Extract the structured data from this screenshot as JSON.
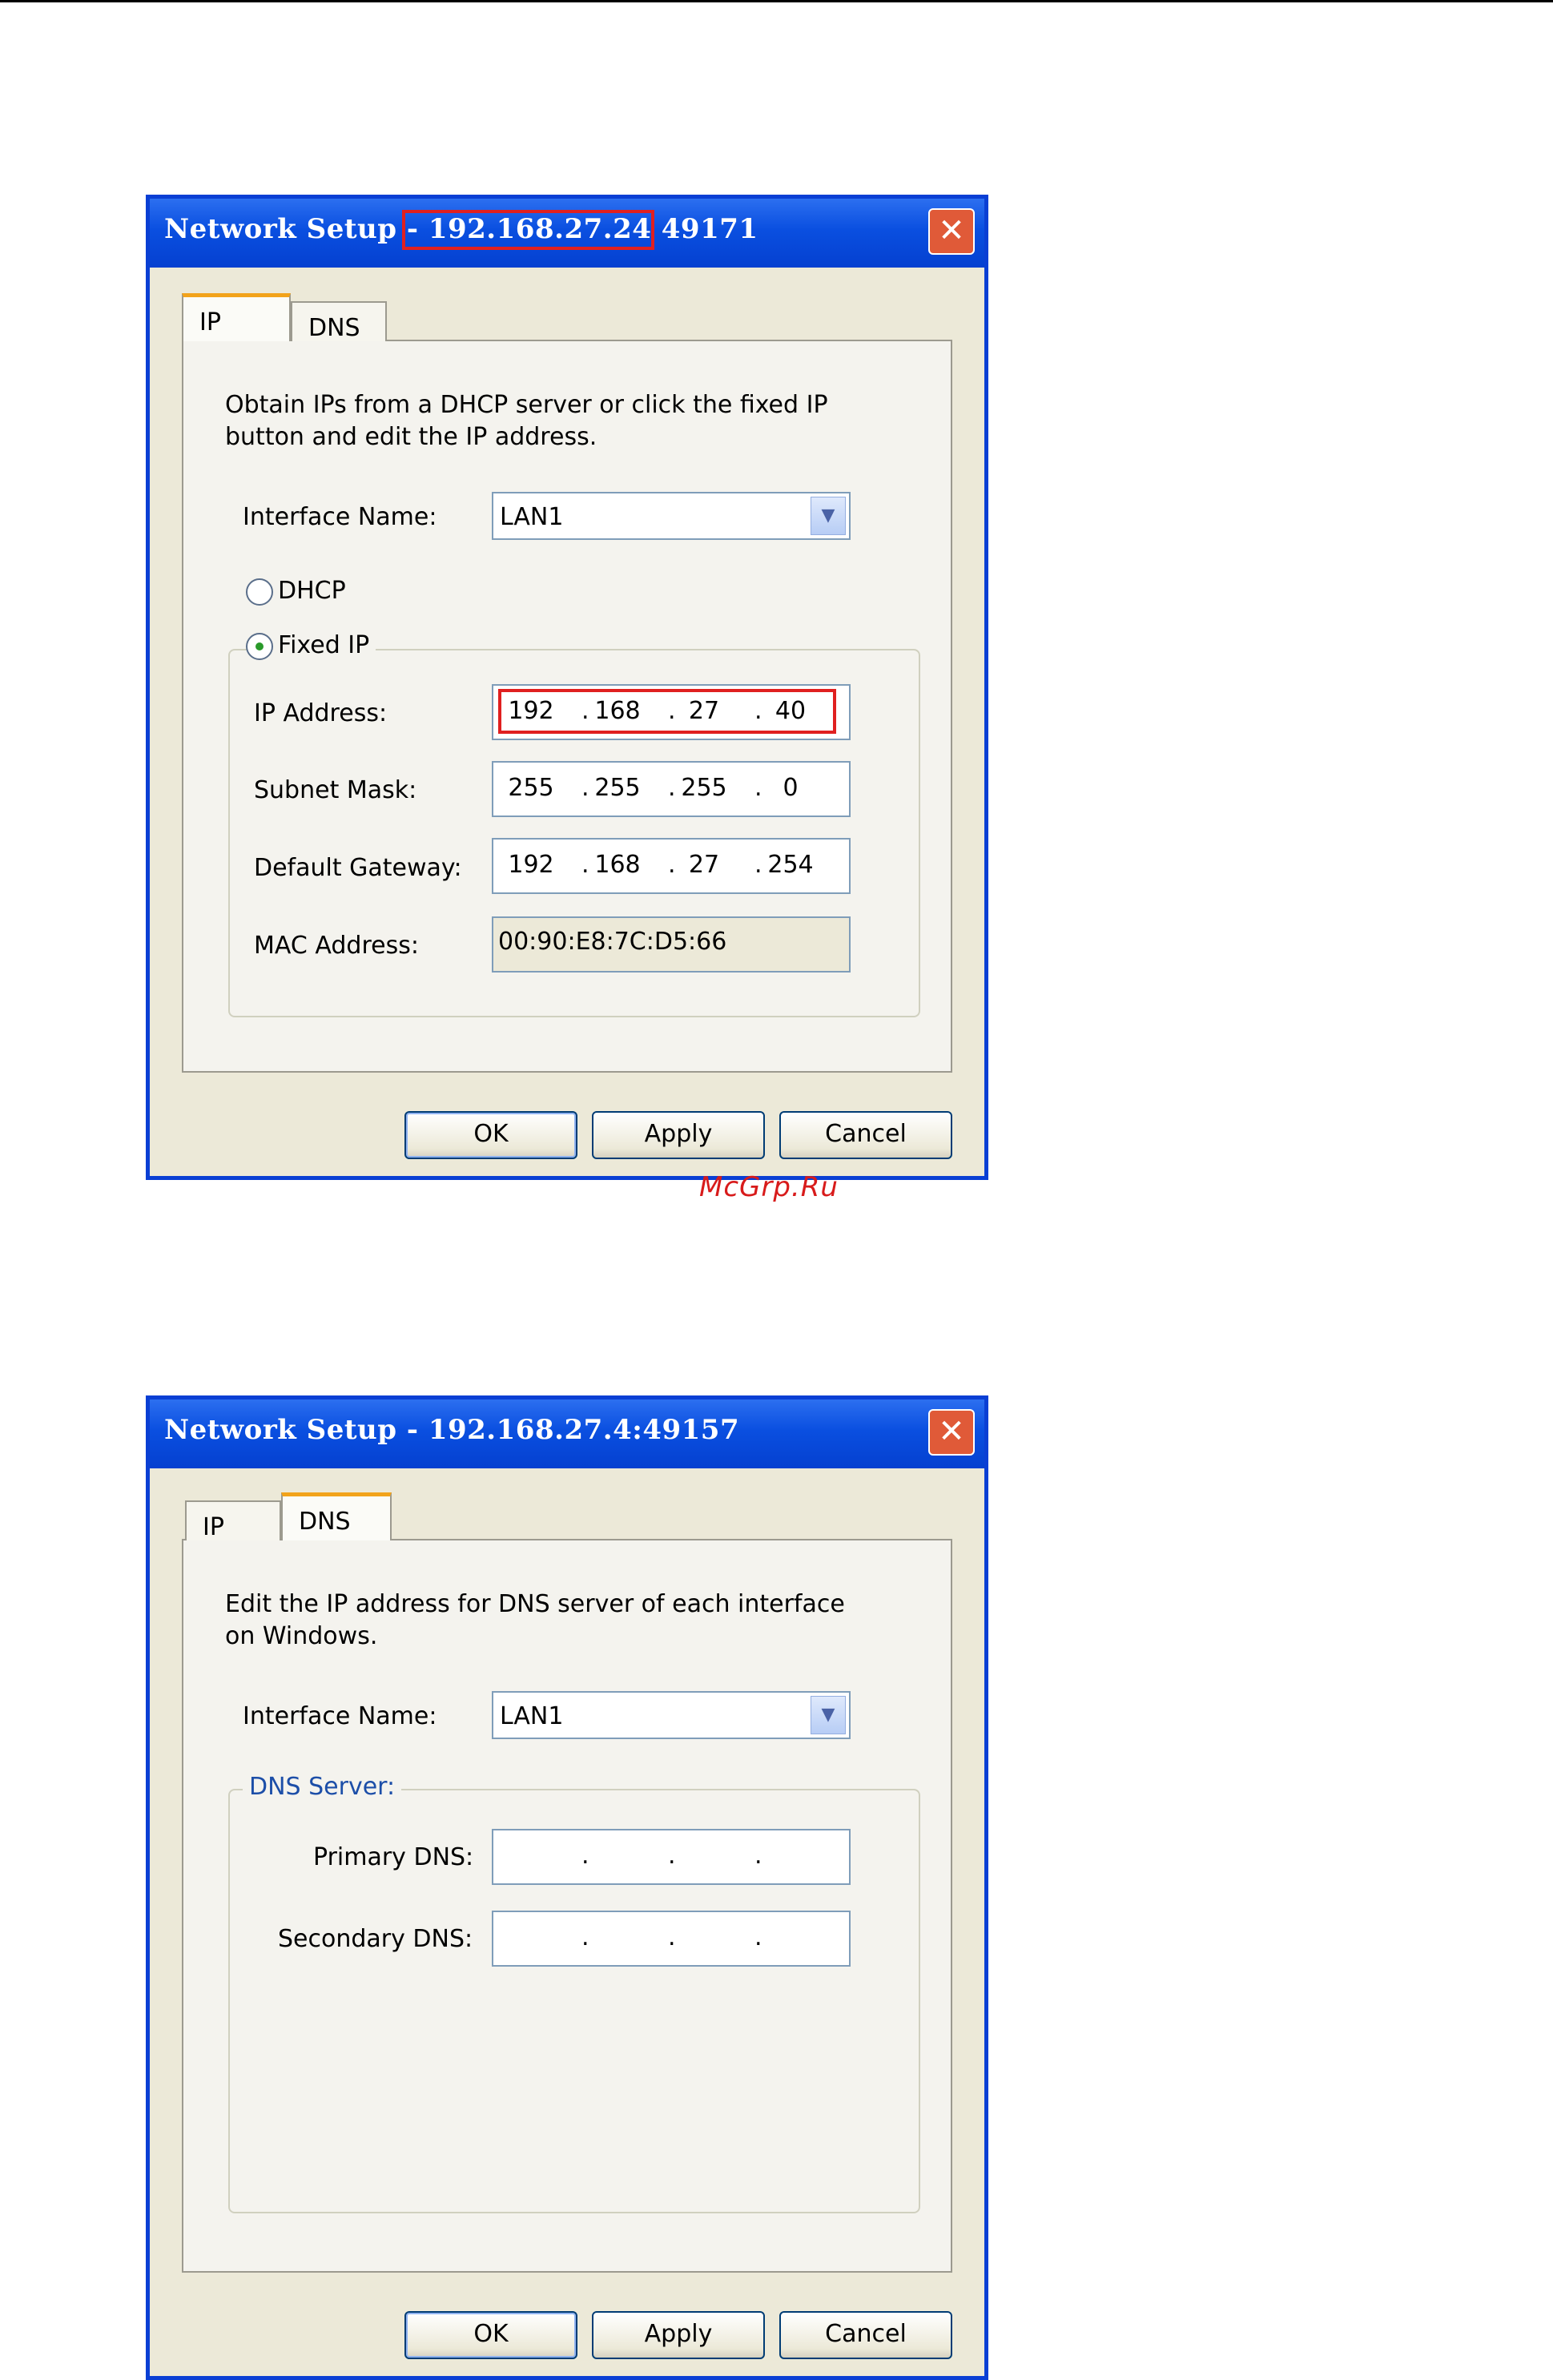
{
  "watermark": "McGrp.Ru",
  "dialog1": {
    "title_prefix": "Network Setup ",
    "title_highlighted": "- 192.168.27.24",
    "title_suffix": " 49171",
    "close_glyph": "✕",
    "tabs": [
      {
        "label": "IP",
        "active": true
      },
      {
        "label": "DNS",
        "active": false
      }
    ],
    "description": "Obtain IPs from a DHCP server or click the fixed IP button and edit the IP address.",
    "interface_label": "Interface Name:",
    "interface_value": "LAN1",
    "dhcp_label": "DHCP",
    "fixed_label": "Fixed IP",
    "selected_mode": "Fixed IP",
    "fields": {
      "ip_label": "IP Address:",
      "ip": [
        "192",
        "168",
        "27",
        "40"
      ],
      "subnet_label": "Subnet Mask:",
      "subnet": [
        "255",
        "255",
        "255",
        "0"
      ],
      "gateway_label": "Default Gateway:",
      "gateway": [
        "192",
        "168",
        "27",
        "254"
      ],
      "mac_label": "MAC Address:",
      "mac": "00:90:E8:7C:D5:66"
    },
    "buttons": {
      "ok": "OK",
      "apply": "Apply",
      "cancel": "Cancel"
    }
  },
  "dialog2": {
    "title": "Network Setup - 192.168.27.4:49157",
    "close_glyph": "✕",
    "tabs": [
      {
        "label": "IP",
        "active": false
      },
      {
        "label": "DNS",
        "active": true
      }
    ],
    "description": "Edit the IP address for DNS server of each interface on Windows.",
    "interface_label": "Interface Name:",
    "interface_value": "LAN1",
    "dns_group_label": "DNS Server:",
    "primary_label": "Primary DNS:",
    "primary": [
      "",
      "",
      "",
      ""
    ],
    "secondary_label": "Secondary DNS:",
    "secondary": [
      "",
      "",
      "",
      ""
    ],
    "buttons": {
      "ok": "OK",
      "apply": "Apply",
      "cancel": "Cancel"
    }
  },
  "colors": {
    "titlebar": "#0a4fe0",
    "highlight": "#e02020",
    "watermark": "#d81b1b",
    "dialog_bg": "#ece9d8",
    "tab_accent": "#f2a31b"
  }
}
